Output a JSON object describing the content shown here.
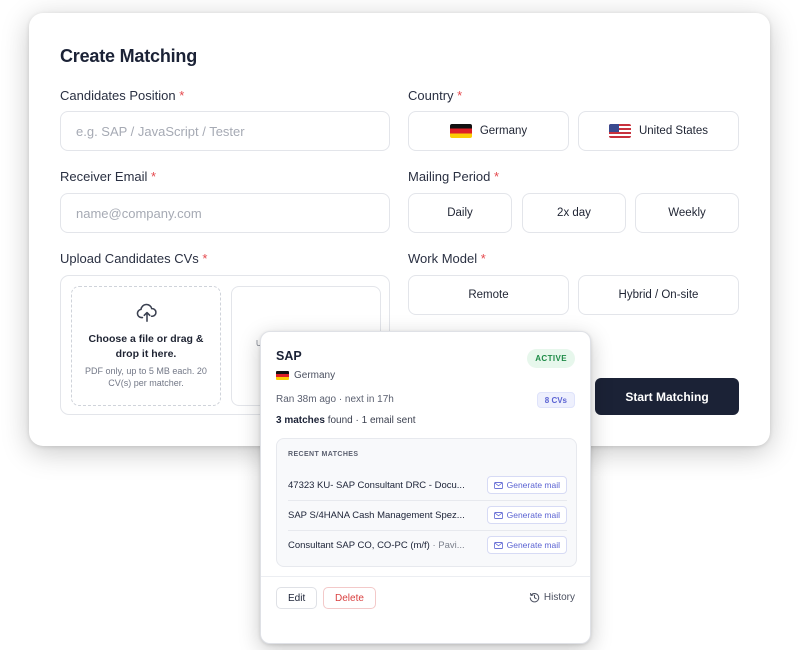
{
  "form": {
    "title": "Create Matching",
    "required_mark": "*",
    "position": {
      "label": "Candidates Position",
      "placeholder": "e.g. SAP / JavaScript / Tester",
      "value": ""
    },
    "country": {
      "label": "Country",
      "options": [
        {
          "label": "Germany",
          "flag": "flag-de"
        },
        {
          "label": "United States",
          "flag": "flag-us"
        }
      ]
    },
    "email": {
      "label": "Receiver Email",
      "placeholder": "name@company.com",
      "value": ""
    },
    "mailing_period": {
      "label": "Mailing Period",
      "options": [
        "Daily",
        "2x day",
        "Weekly"
      ]
    },
    "upload": {
      "label": "Upload Candidates CVs",
      "icon": "upload-cloud-icon",
      "dropzone_title": "Choose a file or drag & drop it here.",
      "dropzone_sub": "PDF only, up to 5 MB each. 20 CV(s) per matcher.",
      "second_slot_text": "U"
    },
    "work_model": {
      "label": "Work Model",
      "options": [
        "Remote",
        "Hybrid / On-site"
      ]
    },
    "start_button": "Start Matching"
  },
  "popup": {
    "title": "SAP",
    "status": "ACTIVE",
    "country": "Germany",
    "country_flag": "flag-de",
    "ran_text": "Ran 38m ago · next in 17h",
    "cv_badge": "8 CVs",
    "matches_count": "3 matches",
    "found_text": " found · 1 email sent",
    "recent_header": "RECENT MATCHES",
    "recent": [
      {
        "title": "47323 KU- SAP Consultant DRC - Docu...",
        "extra": "",
        "action": "Generate mail"
      },
      {
        "title": "SAP S/4HANA Cash Management Spez...",
        "extra": "",
        "action": "Generate mail"
      },
      {
        "title": "Consultant SAP CO, CO-PC (m/f)",
        "extra": " · Pavi...",
        "action": "Generate mail"
      }
    ],
    "edit_label": "Edit",
    "delete_label": "Delete",
    "history_label": "History",
    "history_icon": "history-icon"
  },
  "colors": {
    "primary_dark": "#1b2236",
    "required_red": "#e5484d",
    "active_green": "#1e8b47",
    "accent_indigo": "#5b63d3",
    "delete_red": "#d93f3f"
  }
}
